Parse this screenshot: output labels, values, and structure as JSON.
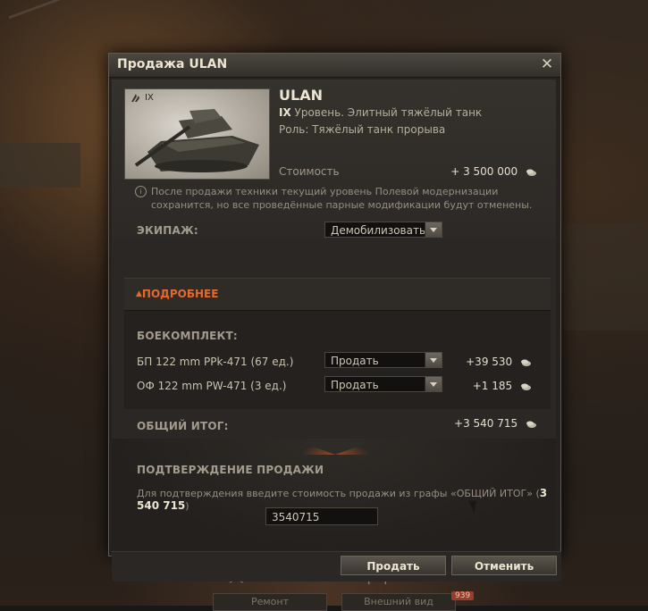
{
  "dialog": {
    "title": "Продажа ULAN",
    "close_icon": "close-icon"
  },
  "vehicle": {
    "tier_badge": "IX",
    "name": "ULAN",
    "tier_num": "IX",
    "tier_text": " Уровень. Элитный тяжёлый танк",
    "role": "Роль: Тяжёлый танк прорыва",
    "cost_label": "Стоимость",
    "cost_value": "+ 3 500 000"
  },
  "info": {
    "text": "После продажи техники текущий уровень Полевой модернизации сохранится, но все проведённые парные модификации будут отменены."
  },
  "crew": {
    "label": "ЭКИПАЖ:",
    "selected": "Демобилизовать"
  },
  "details": {
    "toggle_label": "ПОДРОБНЕЕ",
    "ammo_label": "БОЕКОМПЛЕКТ:",
    "rows": [
      {
        "name": "БП 122 mm PPk-471 (67 ед.)",
        "action": "Продать",
        "value": "+39 530"
      },
      {
        "name": "ОФ 122 mm PW-471 (3 ед.)",
        "action": "Продать",
        "value": "+1 185"
      }
    ]
  },
  "total": {
    "label": "ОБЩИЙ ИТОГ:",
    "value": "+3 540 715"
  },
  "confirm": {
    "title": "ПОДТВЕРЖДЕНИЕ ПРОДАЖИ",
    "hint_prefix": "Для подтверждения введите стоимость продажи из графы «ОБЩИЙ ИТОГ» (",
    "hint_value": "3 540 715",
    "hint_suffix": ")",
    "input_value": "3540715"
  },
  "buttons": {
    "sell": "Продать",
    "cancel": "Отменить"
  },
  "background": {
    "hint": "Тяжёлый танк прорыва",
    "btn_repair": "Ремонт",
    "btn_exterior": "Внешний вид",
    "badge": "939"
  },
  "colors": {
    "accent_orange": "#e8672c",
    "dialog_bg": "#25221f",
    "text_primary": "#ece5d2"
  }
}
